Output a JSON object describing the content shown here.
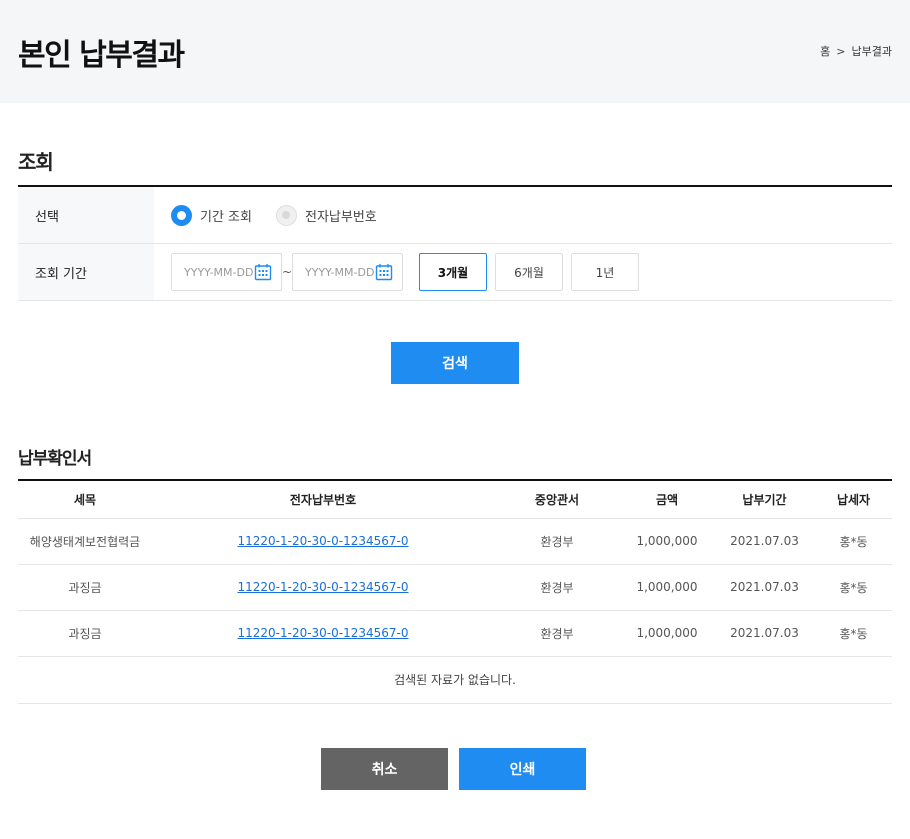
{
  "header": {
    "title": "본인 납부결과",
    "breadcrumb": {
      "home": "홈",
      "current": "납부결과"
    }
  },
  "search_section": {
    "title": "조회",
    "select_label": "선택",
    "radio_options": [
      {
        "label": "기간 조회",
        "selected": true
      },
      {
        "label": "전자납부번호",
        "selected": false
      }
    ],
    "period_label": "조회 기간",
    "date_from_placeholder": "YYYY-MM-DD",
    "date_to_placeholder": "YYYY-MM-DD",
    "date_separator": "~",
    "period_buttons": [
      {
        "label": "3개월",
        "active": true
      },
      {
        "label": "6개월",
        "active": false
      },
      {
        "label": "1년",
        "active": false
      }
    ],
    "search_button": "검색"
  },
  "results": {
    "title": "납부확인서",
    "columns": [
      "세목",
      "전자납부번호",
      "중앙관서",
      "금액",
      "납부기간",
      "납세자"
    ],
    "rows": [
      [
        "해양생태계보전협력금",
        "11220-1-20-30-0-1234567-0",
        "환경부",
        "1,000,000",
        "2021.07.03",
        "홍*동"
      ],
      [
        "과징금",
        "11220-1-20-30-0-1234567-0",
        "환경부",
        "1,000,000",
        "2021.07.03",
        "홍*동"
      ],
      [
        "과징금",
        "11220-1-20-30-0-1234567-0",
        "환경부",
        "1,000,000",
        "2021.07.03",
        "홍*동"
      ]
    ],
    "empty_message": "검색된 자료가 없습니다."
  },
  "actions": {
    "cancel": "취소",
    "print": "인쇄"
  },
  "colors": {
    "accent": "#1e8cf0",
    "link": "#1a6fd8",
    "cancel": "#646464",
    "header_bg": "#f5f6f8"
  }
}
